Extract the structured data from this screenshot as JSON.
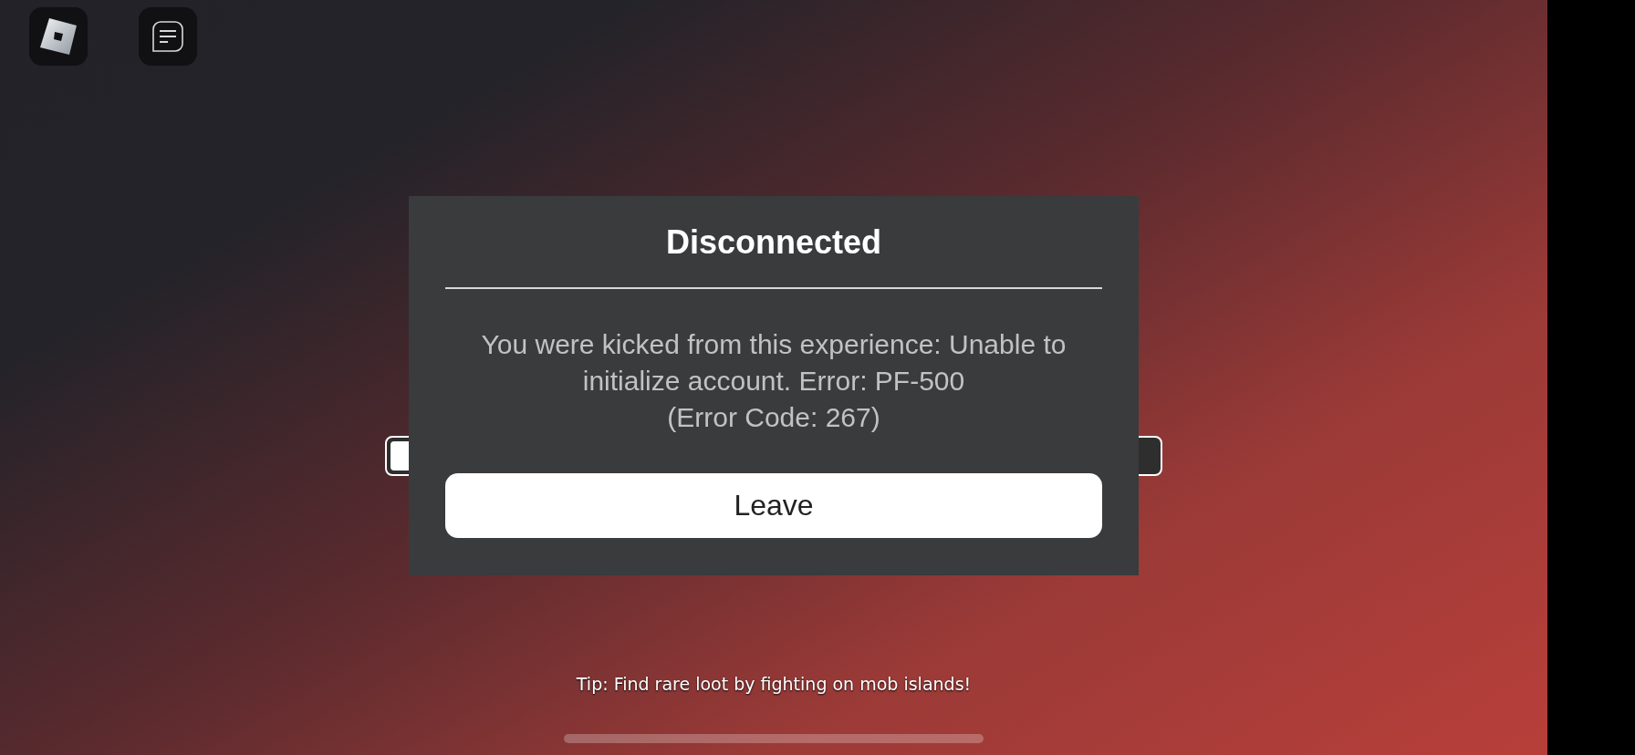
{
  "top_buttons": [
    {
      "kind": "roblox"
    },
    {
      "kind": "chat"
    }
  ],
  "dialog": {
    "title": "Disconnected",
    "message": "You were kicked from this experience: Unable to initialize account. Error: PF-500",
    "code": "(Error Code: 267)",
    "button": "Leave"
  },
  "tip": "Tip: Find rare loot by fighting on mob islands!"
}
